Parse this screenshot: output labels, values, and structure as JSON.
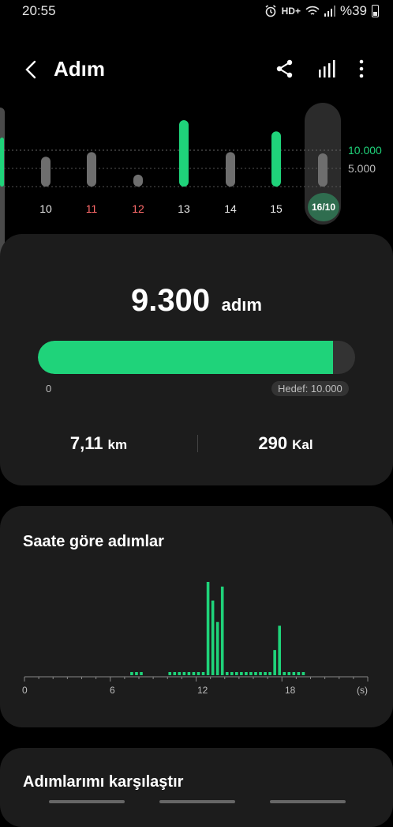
{
  "status": {
    "time": "20:55",
    "network": "HD+",
    "battery": "%39"
  },
  "header": {
    "title": "Adım",
    "icons": [
      "back-icon",
      "share-icon",
      "bar-chart-icon",
      "more-icon"
    ]
  },
  "week": {
    "days": [
      {
        "label": "10",
        "weekend": false,
        "level": 0.45
      },
      {
        "label": "11",
        "weekend": true,
        "level": 0.52
      },
      {
        "label": "12",
        "weekend": true,
        "level": 0.18
      },
      {
        "label": "13",
        "weekend": false,
        "level": 1.0,
        "goal_met": true
      },
      {
        "label": "14",
        "weekend": false,
        "level": 0.52
      },
      {
        "label": "15",
        "weekend": false,
        "level": 0.83,
        "goal_met": true
      },
      {
        "label": "16/10",
        "weekend": false,
        "level": 0.5,
        "selected": true
      }
    ],
    "goal_label": "10.000",
    "mid_label": "5.000"
  },
  "summary": {
    "steps": "9.300",
    "steps_unit": "adım",
    "progress": 0.93,
    "zero_label": "0",
    "goal_label": "Hedef: 10.000",
    "distance": "7,11",
    "distance_unit": "km",
    "calories": "290",
    "calories_unit": "Kal"
  },
  "hourly": {
    "title": "Saate göre adımlar",
    "axis_labels": [
      "0",
      "6",
      "12",
      "18",
      "(s)"
    ],
    "values": [
      0,
      0,
      0,
      0,
      0,
      0,
      0,
      0,
      0,
      0,
      0,
      0,
      0,
      0,
      0,
      0,
      0,
      0,
      0,
      0,
      0,
      0,
      0.03,
      0.03,
      0.03,
      0,
      0,
      0,
      0,
      0,
      0.03,
      0.03,
      0.03,
      0.03,
      0.03,
      0.03,
      0.03,
      0.03,
      1.0,
      0.8,
      0.57,
      0.95,
      0.03,
      0.03,
      0.03,
      0.03,
      0.03,
      0.03,
      0.03,
      0.03,
      0.03,
      0.03,
      0.27,
      0.53,
      0.03,
      0.03,
      0.03,
      0.03,
      0.03,
      0,
      0,
      0,
      0,
      0,
      0,
      0,
      0,
      0,
      0,
      0,
      0,
      0
    ]
  },
  "compare": {
    "title": "Adımlarımı karşılaştır"
  },
  "colors": {
    "accent": "#1fd37a",
    "card": "#1c1c1c",
    "inactive_bar": "#6e6e6e"
  }
}
